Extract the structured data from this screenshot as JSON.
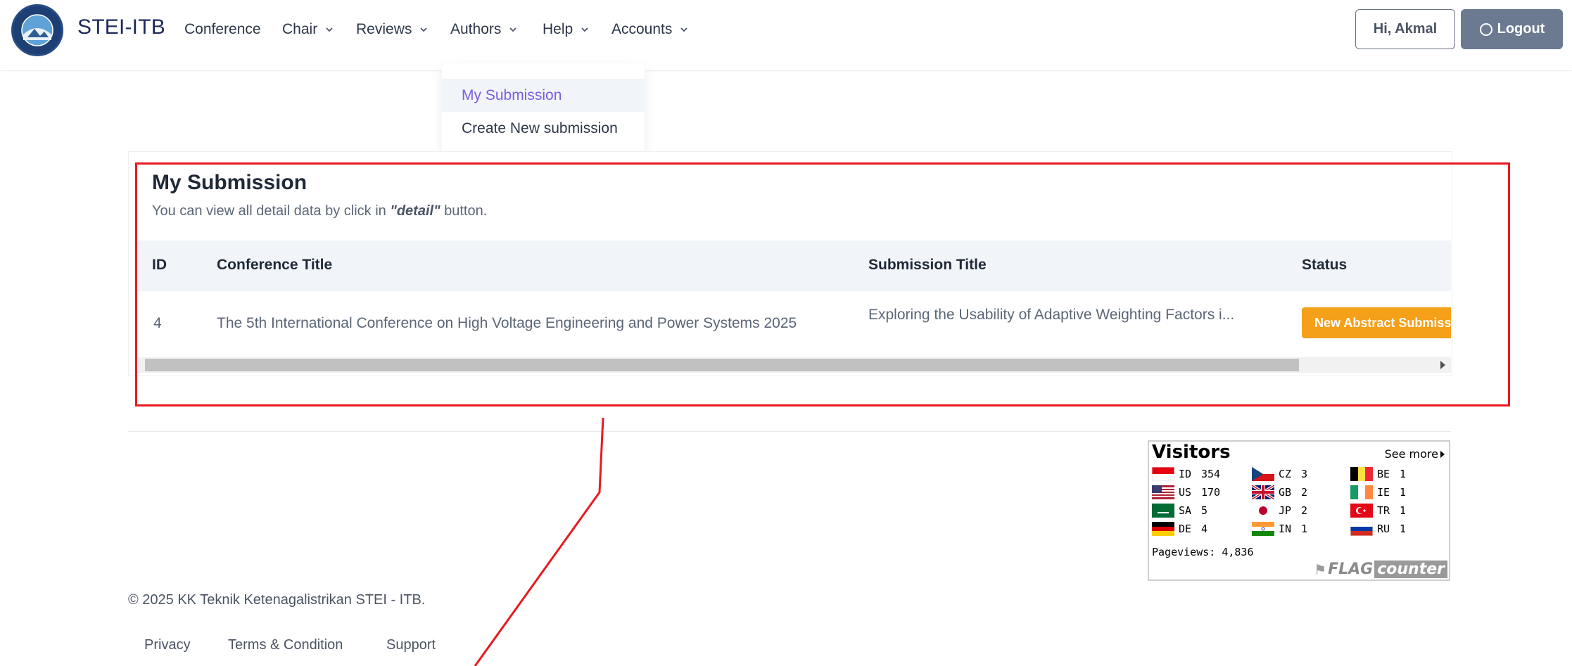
{
  "brand": {
    "name": "STEI-ITB"
  },
  "nav": {
    "items": [
      {
        "label": "Conference",
        "has_dropdown": false
      },
      {
        "label": "Chair",
        "has_dropdown": true
      },
      {
        "label": "Reviews",
        "has_dropdown": true
      },
      {
        "label": "Authors",
        "has_dropdown": true
      },
      {
        "label": "Help",
        "has_dropdown": true
      },
      {
        "label": "Accounts",
        "has_dropdown": true
      }
    ],
    "greeting": "Hi, Akmal",
    "logout": "Logout"
  },
  "dropdown": {
    "items": [
      {
        "label": "My Submission",
        "active": true
      },
      {
        "label": "Create New submission",
        "active": false
      }
    ]
  },
  "submission": {
    "title": "My Submission",
    "subtitle_pre": "You can view all detail data by click in ",
    "subtitle_em": "\"detail\"",
    "subtitle_post": " button.",
    "columns": [
      "ID",
      "Conference Title",
      "Submission Title",
      "Status"
    ],
    "rows": [
      {
        "id": "4",
        "conference_title": "The 5th International Conference on High Voltage Engineering and Power Systems 2025",
        "submission_title": "Exploring the Usability of Adaptive Weighting Factors i...",
        "status": "New Abstract Submission"
      }
    ]
  },
  "visitors": {
    "title": "Visitors",
    "see_more": "See more",
    "entries": [
      {
        "code": "ID",
        "count": "354"
      },
      {
        "code": "US",
        "count": "170"
      },
      {
        "code": "SA",
        "count": "5"
      },
      {
        "code": "DE",
        "count": "4"
      },
      {
        "code": "CZ",
        "count": "3"
      },
      {
        "code": "GB",
        "count": "2"
      },
      {
        "code": "JP",
        "count": "2"
      },
      {
        "code": "IN",
        "count": "1"
      },
      {
        "code": "BE",
        "count": "1"
      },
      {
        "code": "IE",
        "count": "1"
      },
      {
        "code": "TR",
        "count": "1"
      },
      {
        "code": "RU",
        "count": "1"
      }
    ],
    "pageviews_label": "Pageviews:",
    "pageviews_value": "4,836",
    "badge_flag": "FLAG",
    "badge_counter": "counter"
  },
  "footer": {
    "copyright": "© 2025 KK Teknik Ketenagalistrikan STEI - ITB.",
    "links": [
      "Privacy",
      "Terms & Condition",
      "Support"
    ]
  },
  "colors": {
    "status_badge": "#f4a019",
    "active_menu": "#7c5ce0",
    "annotation": "#e8191f",
    "logout_button": "#6b7a90"
  }
}
